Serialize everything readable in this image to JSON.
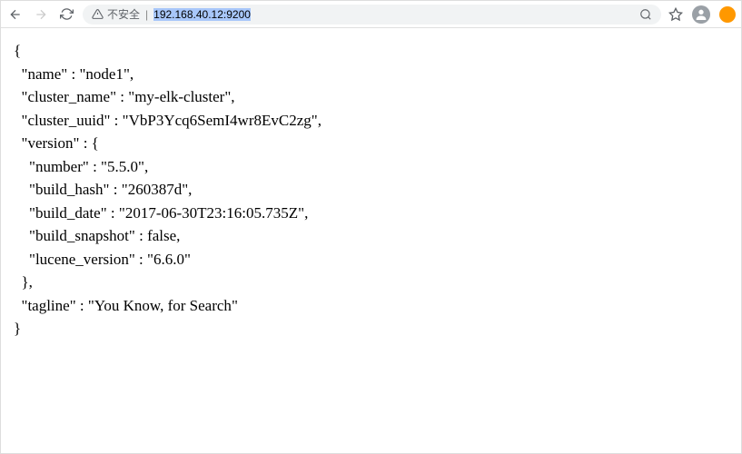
{
  "addressbar": {
    "security_label": "不安全",
    "url": "192.168.40.12:9200"
  },
  "json_response": {
    "name": "node1",
    "cluster_name": "my-elk-cluster",
    "cluster_uuid": "VbP3Ycq6SemI4wr8EvC2zg",
    "version": {
      "number": "5.5.0",
      "build_hash": "260387d",
      "build_date": "2017-06-30T23:16:05.735Z",
      "build_snapshot": "false",
      "lucene_version": "6.6.0"
    },
    "tagline": "You Know, for Search"
  }
}
